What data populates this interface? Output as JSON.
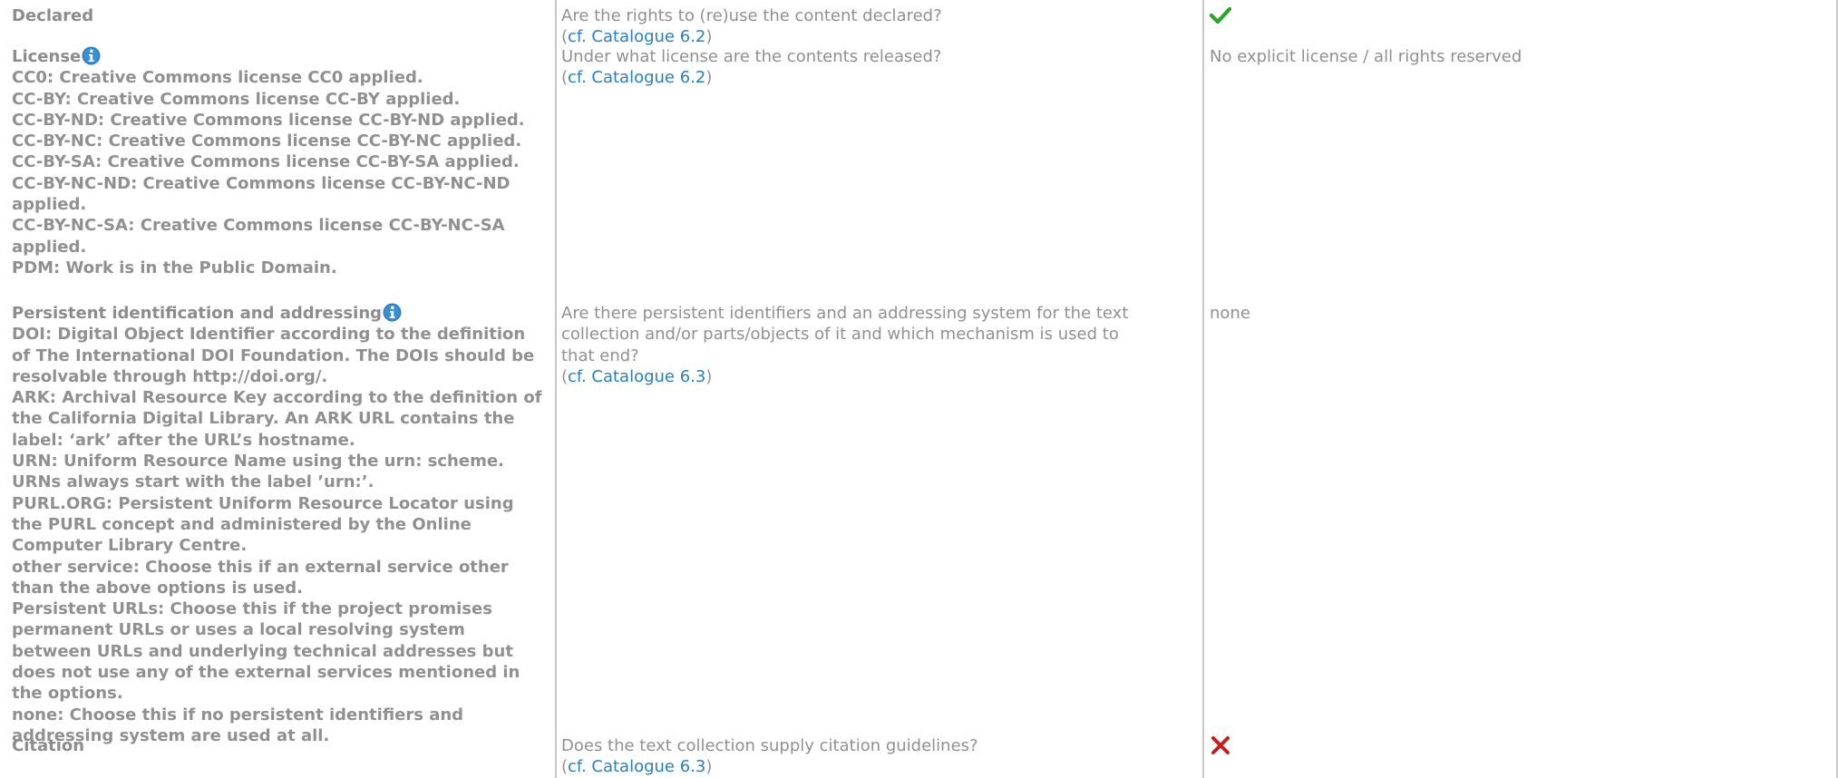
{
  "rows": [
    {
      "label": "Declared",
      "question": "Are the rights to (re)use the content declared?",
      "ref_open": "(",
      "ref_link": "cf. Catalogue 6.2",
      "ref_close": ")",
      "value_icon": "check-icon",
      "value_color": "#22a822"
    },
    {
      "label": "License",
      "has_info": true,
      "options": [
        "CC0: Creative Commons license CC0 applied.",
        "CC-BY: Creative Commons license CC-BY applied.",
        "CC-BY-ND: Creative Commons license CC-BY-ND applied.",
        "CC-BY-NC: Creative Commons license CC-BY-NC applied.",
        "CC-BY-SA: Creative Commons license CC-BY-SA applied.",
        "CC-BY-NC-ND: Creative Commons license CC-BY-NC-ND applied.",
        "CC-BY-NC-SA: Creative Commons license CC-BY-NC-SA applied.",
        "PDM: Work is in the Public Domain."
      ],
      "question": "Under what license are the contents released?",
      "ref_open": "(",
      "ref_link": "cf. Catalogue 6.2",
      "ref_close": ")",
      "value": "No explicit license / all rights reserved"
    },
    {
      "label": "Persistent identification and addressing",
      "has_info": true,
      "options": [
        "DOI: Digital Object Identifier according to the definition of The International DOI Foundation. The DOIs should be resolvable through http://doi.org/.",
        "ARK: Archival Resource Key according to the definition of the California Digital Library. An ARK URL contains the label: ‘ark’ after the URL’s hostname.",
        "URN: Uniform Resource Name using the urn: scheme. URNs always start with the label ’urn:’.",
        "PURL.ORG: Persistent Uniform Resource Locator using the PURL concept and administered by the Online Computer Library Centre.",
        "other service: Choose this if an external service other than the above options is used.",
        "Persistent URLs: Choose this if the project promises permanent URLs or uses a local resolving system between URLs and underlying technical addresses but does not use any of the external services mentioned in the options.",
        "none: Choose this if no persistent identifiers and addressing system are used at all."
      ],
      "question": "Are there persistent identifiers and an addressing system for the text collection and/or parts/objects of it and which mechanism is used to that end?",
      "ref_open": "(",
      "ref_link": "cf. Catalogue 6.3",
      "ref_close": ")",
      "value": "none"
    },
    {
      "label": "Citation",
      "question": "Does the text collection supply citation guidelines?",
      "ref_open": "(",
      "ref_link": "cf. Catalogue 6.3",
      "ref_close": ")",
      "value_icon": "cross-icon",
      "value_color": "#c41e1e"
    }
  ],
  "colors": {
    "text": "#909090",
    "link": "#2a7fc0",
    "info": "#2a7fc0",
    "divider": "#c7c7c7"
  }
}
